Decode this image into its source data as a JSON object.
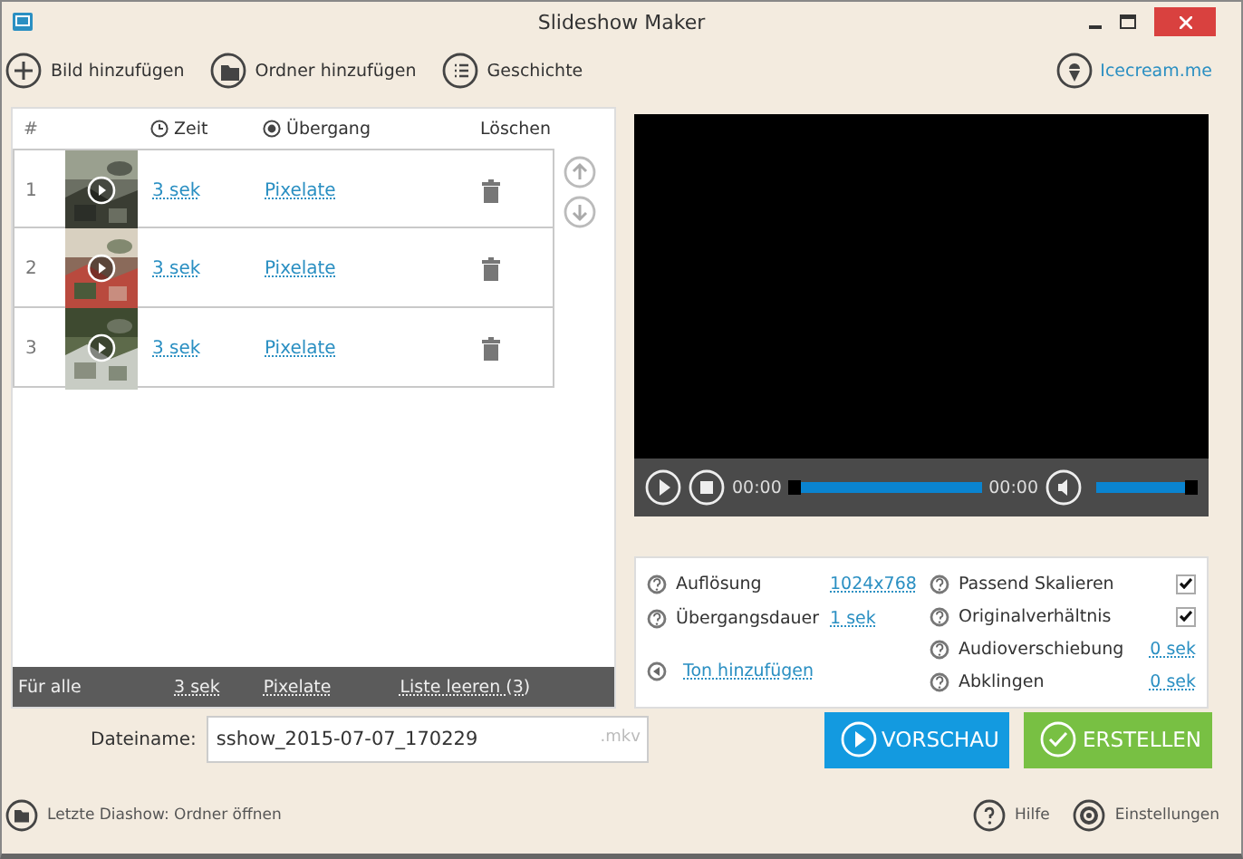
{
  "window": {
    "title": "Slideshow Maker"
  },
  "toolbar": [
    {
      "label": "Bild hinzufügen",
      "kind": "add"
    },
    {
      "label": "Ordner hinzufügen",
      "kind": "folder"
    },
    {
      "label": "Geschichte",
      "kind": "list"
    }
  ],
  "brand_link": "Icecream.me",
  "slides": {
    "columns": [
      "#",
      "Zeit",
      "Übergang",
      "Löschen"
    ],
    "rows": [
      {
        "number": "1",
        "time": "3 sek",
        "transition": "Pixelate"
      },
      {
        "number": "2",
        "time": "3 sek",
        "transition": "Pixelate"
      },
      {
        "number": "3",
        "time": "3 sek",
        "transition": "Pixelate"
      }
    ]
  },
  "footer_bar": {
    "label": "Für alle",
    "time": "3 sek",
    "transition": "Pixelate",
    "clear": "Liste leeren (3)"
  },
  "player": {
    "current": "00:00",
    "total": "00:00",
    "seek": {
      "level": 0
    },
    "volume": {
      "level": 1
    }
  },
  "settings": {
    "left": [
      {
        "label": "Auflösung",
        "value": "1024x768"
      },
      {
        "label": "Übergangsdauer",
        "value": "1 sek"
      }
    ],
    "audio_link": "Ton hinzufügen",
    "right": [
      {
        "label": "Passend Skalieren",
        "kind": "checkbox",
        "checked": true
      },
      {
        "label": "Originalverhältnis",
        "kind": "checkbox",
        "checked": true
      },
      {
        "label": "Audioverschiebung",
        "kind": "link",
        "value": "0 sek"
      },
      {
        "label": "Abklingen",
        "kind": "link",
        "value": "0 sek"
      }
    ]
  },
  "filename": {
    "label": "Dateiname:",
    "value": "sshow_2015-07-07_170229",
    "extension": ".mkv"
  },
  "buttons": [
    {
      "label": "VORSCHAU",
      "kind": "preview"
    },
    {
      "label": "ERSTELLEN",
      "kind": "create"
    }
  ],
  "bottom": {
    "recent": "Letzte Diashow: Ordner öffnen",
    "help": "Hilfe",
    "settings": "Einstellungen"
  }
}
